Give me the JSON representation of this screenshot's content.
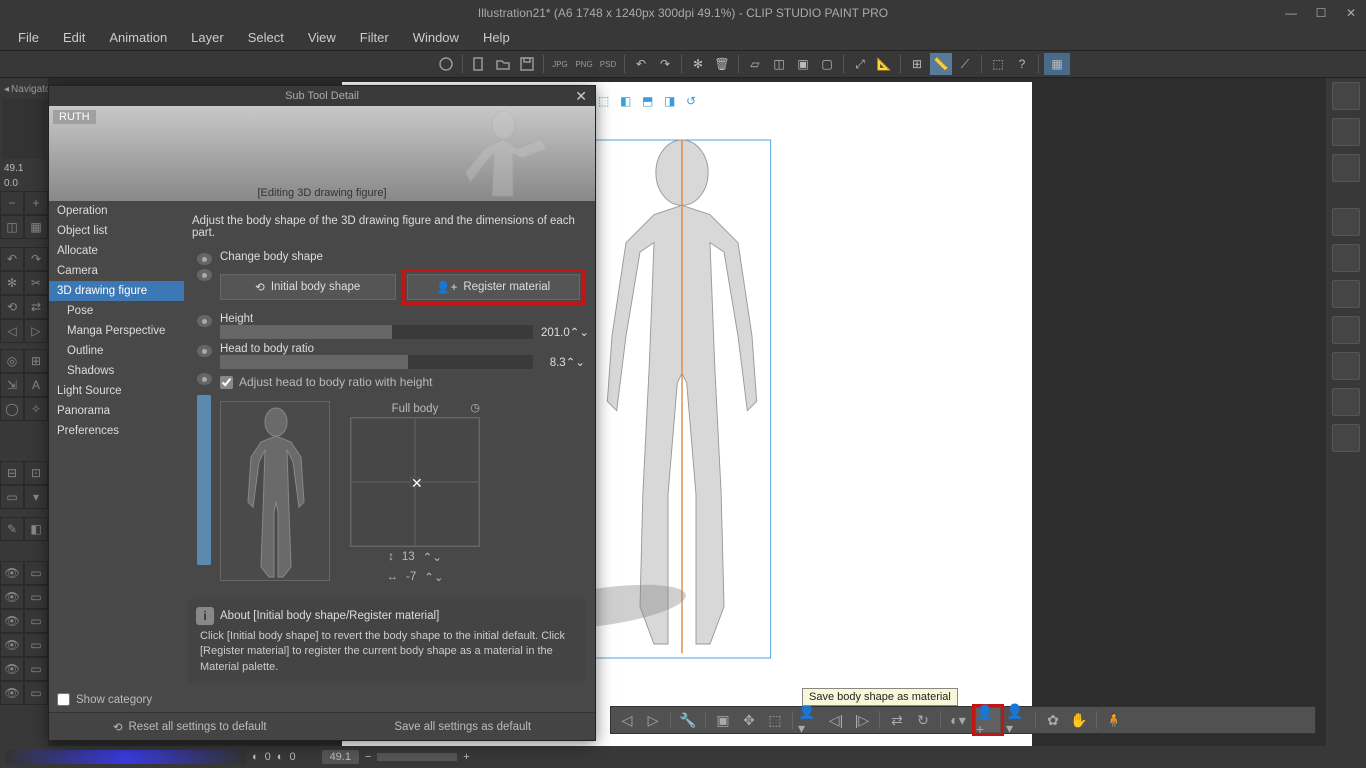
{
  "titlebar": {
    "title": "Illustration21* (A6 1748 x 1240px 300dpi 49.1%)  -  CLIP STUDIO PAINT PRO"
  },
  "menu": [
    "File",
    "Edit",
    "Animation",
    "Layer",
    "Select",
    "View",
    "Filter",
    "Window",
    "Help"
  ],
  "nav": {
    "zoom": "49.1",
    "angle": "0.0",
    "panel": "Navigator"
  },
  "dialog": {
    "title": "Sub Tool Detail",
    "tag": "RUTH",
    "caption": "[Editing 3D drawing figure]",
    "desc": "Adjust the body shape of the 3D drawing figure and the dimensions of each part.",
    "sidebar": [
      "Operation",
      "Object list",
      "Allocate",
      "Camera",
      "3D drawing figure",
      "Pose",
      "Manga Perspective",
      "Outline",
      "Shadows",
      "Light Source",
      "Panorama",
      "Preferences"
    ],
    "selected_index": 4,
    "change_label": "Change body shape",
    "initial_btn": "Initial body shape",
    "register_btn": "Register material",
    "height_label": "Height",
    "height_val": "201.0",
    "ratio_label": "Head to body ratio",
    "ratio_val": "8.3",
    "adjust_chk": "Adjust head to body ratio with height",
    "fullbody": "Full body",
    "spin1": "13",
    "spin2": "-7",
    "about_title": "About [Initial body shape/Register material]",
    "about_text": "Click [Initial body shape] to revert the body shape to the initial default. Click [Register material] to register the current body shape as a material in the Material palette.",
    "show_cat": "Show category",
    "reset": "Reset all settings to default",
    "save_all": "Save all settings as default"
  },
  "tooltip": "Save body shape as material",
  "status": {
    "zoom": "49.1",
    "frame": "0",
    "cpu": "0"
  }
}
